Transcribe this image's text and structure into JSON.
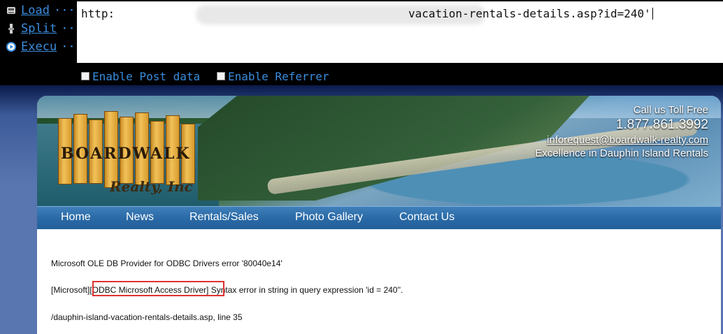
{
  "hackbar": {
    "buttons": [
      {
        "label": "Load",
        "icon": "load-url-icon"
      },
      {
        "label": "Split",
        "icon": "split-url-icon"
      },
      {
        "label": "Execu",
        "icon": "execute-icon"
      }
    ],
    "ellipsis": "···",
    "url_start": "http:",
    "url_end": "vacation-rentals-details.asp?id=240'",
    "enable_post": "Enable Post data",
    "enable_referrer": "Enable Referrer",
    "accent_color": "#3a8dde"
  },
  "site": {
    "logo_main": "BOARDWALK",
    "logo_sub": "Realty, Inc",
    "call_label": "Call us Toll Free",
    "phone": "1.877.861.3992",
    "email": "inforequest@boardwalk-realty.com",
    "tagline": "Excellence in Dauphin Island Rentals",
    "nav": [
      "Home",
      "News",
      "Rentals/Sales",
      "Photo Gallery",
      "Contact Us"
    ]
  },
  "error": {
    "line1": "Microsoft OLE DB Provider for ODBC Drivers  error '80040e14'",
    "line2_pre": "[Microsoft]",
    "line2_highlight": "[ODBC Microsoft Access Driver]",
    "line2_post": " Syntax error in string in query expression 'id = 240''.",
    "line3": "/dauphin-island-vacation-rentals-details.asp, line 35",
    "highlight_color": "#e03131"
  }
}
